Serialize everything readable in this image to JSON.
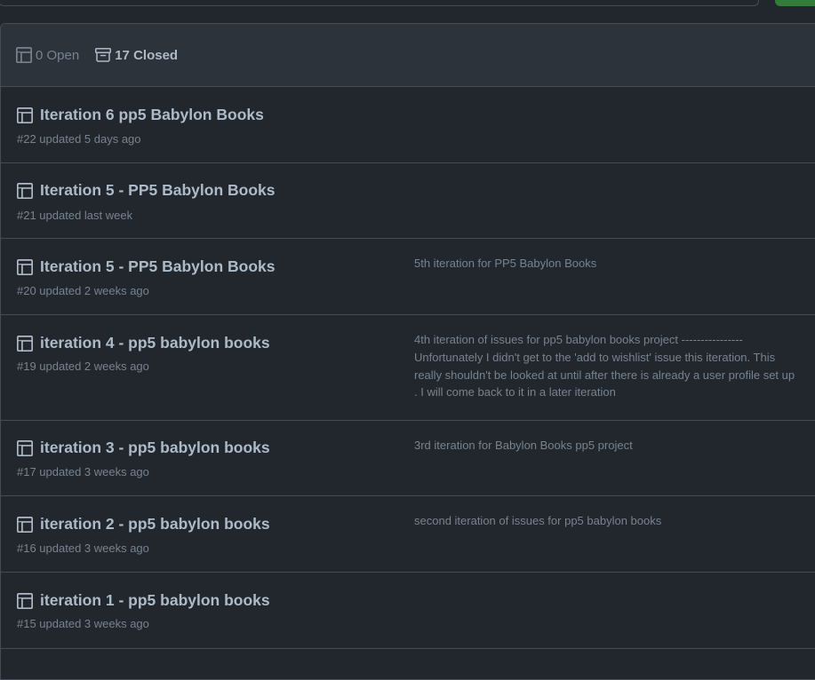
{
  "header": {
    "open_label": "0 Open",
    "closed_label": "17 Closed"
  },
  "projects": [
    {
      "title": "Iteration 6 pp5 Babylon Books",
      "meta": "#22 updated 5 days ago",
      "description": ""
    },
    {
      "title": "Iteration 5 - PP5 Babylon Books",
      "meta": "#21 updated last week",
      "description": ""
    },
    {
      "title": "Iteration 5 - PP5 Babylon Books",
      "meta": "#20 updated 2 weeks ago",
      "description": "5th iteration for PP5 Babylon Books"
    },
    {
      "title": "iteration 4 - pp5 babylon books",
      "meta": "#19 updated 2 weeks ago",
      "description": "4th iteration of issues for pp5 babylon books project ---------------- Unfortunately I didn't get to the 'add to wishlist' issue this iteration. This really shouldn't be looked at until after there is already a user profile set up . I will come back to it in a later iteration"
    },
    {
      "title": "iteration 3 - pp5 babylon books",
      "meta": "#17 updated 3 weeks ago",
      "description": "3rd iteration for Babylon Books pp5 project"
    },
    {
      "title": "iteration 2 - pp5 babylon books",
      "meta": "#16 updated 3 weeks ago",
      "description": "second iteration of issues for pp5 babylon books"
    },
    {
      "title": "iteration 1 - pp5 babylon books",
      "meta": "#15 updated 3 weeks ago",
      "description": ""
    }
  ],
  "colors": {
    "background": "#22272e",
    "header_background": "#2d333b",
    "border": "#444c56",
    "text_primary": "#adbac7",
    "text_muted": "#768390",
    "accent_green": "#347d39"
  },
  "icons": {
    "project": "project-table-icon",
    "closed": "archive-icon"
  }
}
